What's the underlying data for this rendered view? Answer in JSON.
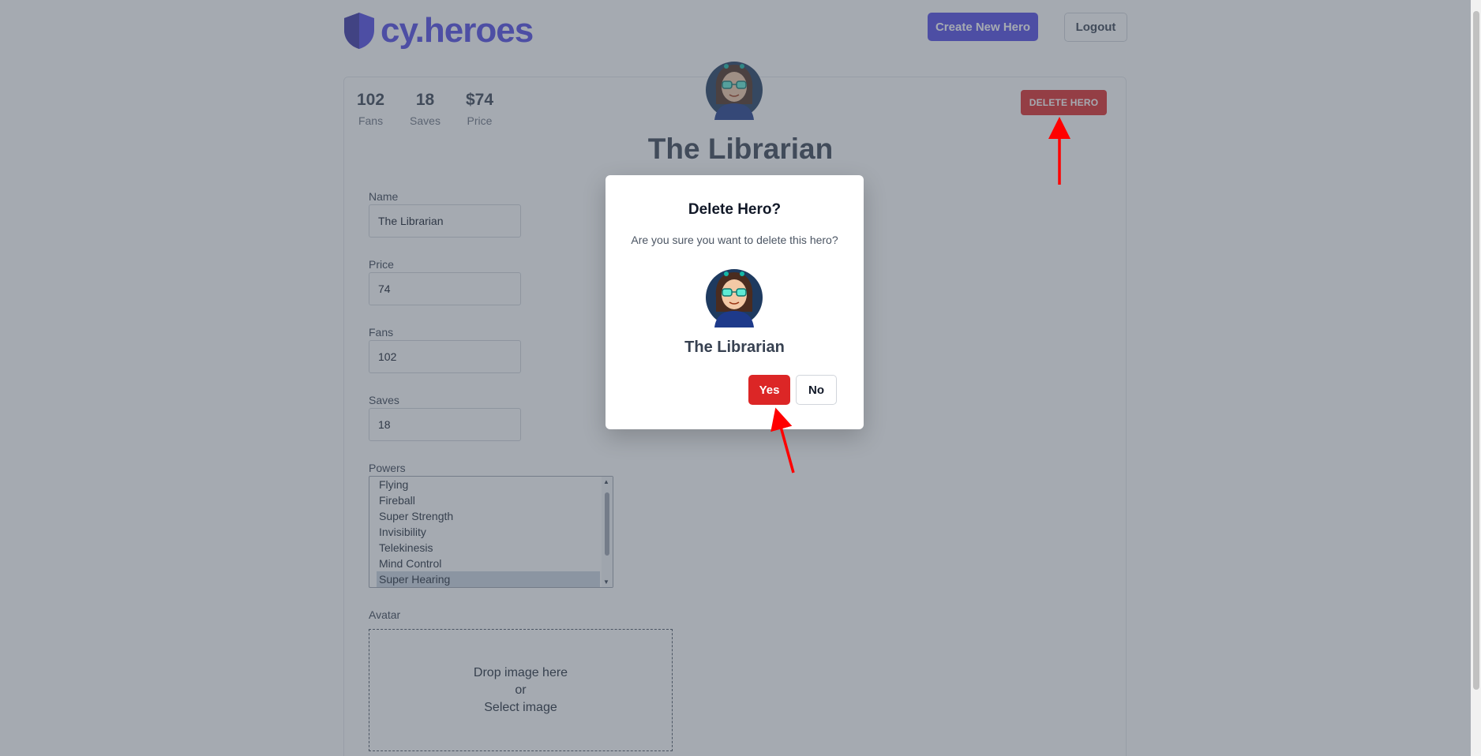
{
  "header": {
    "logo_text": "cy.heroes",
    "create_label": "Create New Hero",
    "logout_label": "Logout"
  },
  "hero": {
    "stats": [
      {
        "value": "102",
        "label": "Fans"
      },
      {
        "value": "18",
        "label": "Saves"
      },
      {
        "value": "$74",
        "label": "Price"
      }
    ],
    "title": "The Librarian",
    "delete_label": "DELETE HERO"
  },
  "form": {
    "name_label": "Name",
    "name_value": "The Librarian",
    "price_label": "Price",
    "price_value": "74",
    "fans_label": "Fans",
    "fans_value": "102",
    "saves_label": "Saves",
    "saves_value": "18",
    "powers_label": "Powers",
    "powers": [
      {
        "label": "Flying",
        "selected": false
      },
      {
        "label": "Fireball",
        "selected": false
      },
      {
        "label": "Super Strength",
        "selected": false
      },
      {
        "label": "Invisibility",
        "selected": false
      },
      {
        "label": "Telekinesis",
        "selected": false
      },
      {
        "label": "Mind Control",
        "selected": false
      },
      {
        "label": "Super Hearing",
        "selected": true
      }
    ],
    "avatar_label": "Avatar",
    "drop_line1": "Drop image here",
    "drop_line2": "or",
    "drop_line3": "Select image"
  },
  "modal": {
    "title": "Delete Hero?",
    "text": "Are you sure you want to delete this hero?",
    "hero_name": "The Librarian",
    "yes_label": "Yes",
    "no_label": "No"
  },
  "colors": {
    "brand": "#4f46e5",
    "danger": "#dc2626",
    "annotation_arrow": "#ff0000"
  }
}
